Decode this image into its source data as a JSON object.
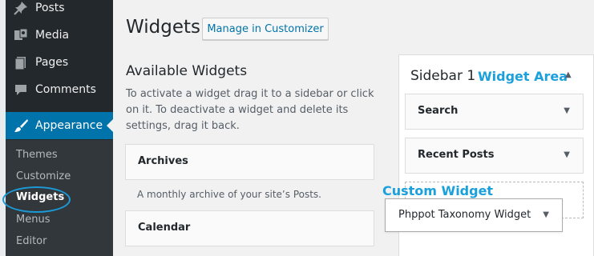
{
  "menu": {
    "items": [
      {
        "label": "Posts",
        "icon": "pushpin-icon"
      },
      {
        "label": "Media",
        "icon": "media-icon"
      },
      {
        "label": "Pages",
        "icon": "pages-icon"
      },
      {
        "label": "Comments",
        "icon": "comments-icon"
      },
      {
        "label": "Appearance",
        "icon": "paintbrush-icon",
        "active": true
      }
    ],
    "submenu": [
      "Themes",
      "Customize",
      "Widgets",
      "Menus",
      "Editor"
    ],
    "current_submenu": "Widgets"
  },
  "header": {
    "title": "Widgets",
    "customizer_button": "Manage in Customizer"
  },
  "available": {
    "title": "Available Widgets",
    "description": "To activate a widget drag it to a sidebar or click on it. To deactivate a widget and delete its settings, drag it back.",
    "widgets": [
      {
        "label": "Archives",
        "description": "A monthly archive of your site’s Posts."
      },
      {
        "label": "Calendar"
      }
    ]
  },
  "sidebar_area": {
    "title": "Sidebar 1",
    "widgets": [
      "Search",
      "Recent Posts"
    ]
  },
  "dragging_widget": "Phppot Taxonomy Widget",
  "annotations": {
    "widget_area": "Widget Area",
    "custom_widget": "Custom Widget"
  },
  "colors": {
    "admin_menu_bg": "#23282d",
    "submenu_bg": "#32373c",
    "active_menu_bg": "#0073aa",
    "annotation": "#1aa0dc"
  }
}
